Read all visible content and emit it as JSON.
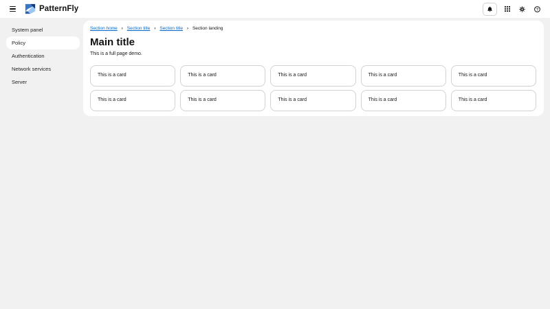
{
  "header": {
    "brand": "PatternFly"
  },
  "sidebar": {
    "items": [
      {
        "label": "System panel",
        "selected": false
      },
      {
        "label": "Policy",
        "selected": true
      },
      {
        "label": "Authentication",
        "selected": false
      },
      {
        "label": "Network services",
        "selected": false
      },
      {
        "label": "Server",
        "selected": false
      }
    ]
  },
  "breadcrumb": [
    {
      "label": "Section home",
      "link": true
    },
    {
      "label": "Section title",
      "link": true
    },
    {
      "label": "Section title",
      "link": true
    },
    {
      "label": "Section landing",
      "link": false
    }
  ],
  "main": {
    "title": "Main title",
    "subtitle": "This is a full page demo.",
    "cards": [
      "This is a card",
      "This is a card",
      "This is a card",
      "This is a card",
      "This is a card",
      "This is a card",
      "This is a card",
      "This is a card",
      "This is a card",
      "This is a card"
    ]
  },
  "colors": {
    "link_blue": "#0066cc",
    "page_background": "#f1f1f2",
    "panel_background": "#ffffff",
    "text": "#151515",
    "card_border": "#d2d2d2",
    "logo_blues": [
      "#9cc7f2",
      "#3a77c2",
      "#123c78",
      "#2b62a8"
    ]
  }
}
